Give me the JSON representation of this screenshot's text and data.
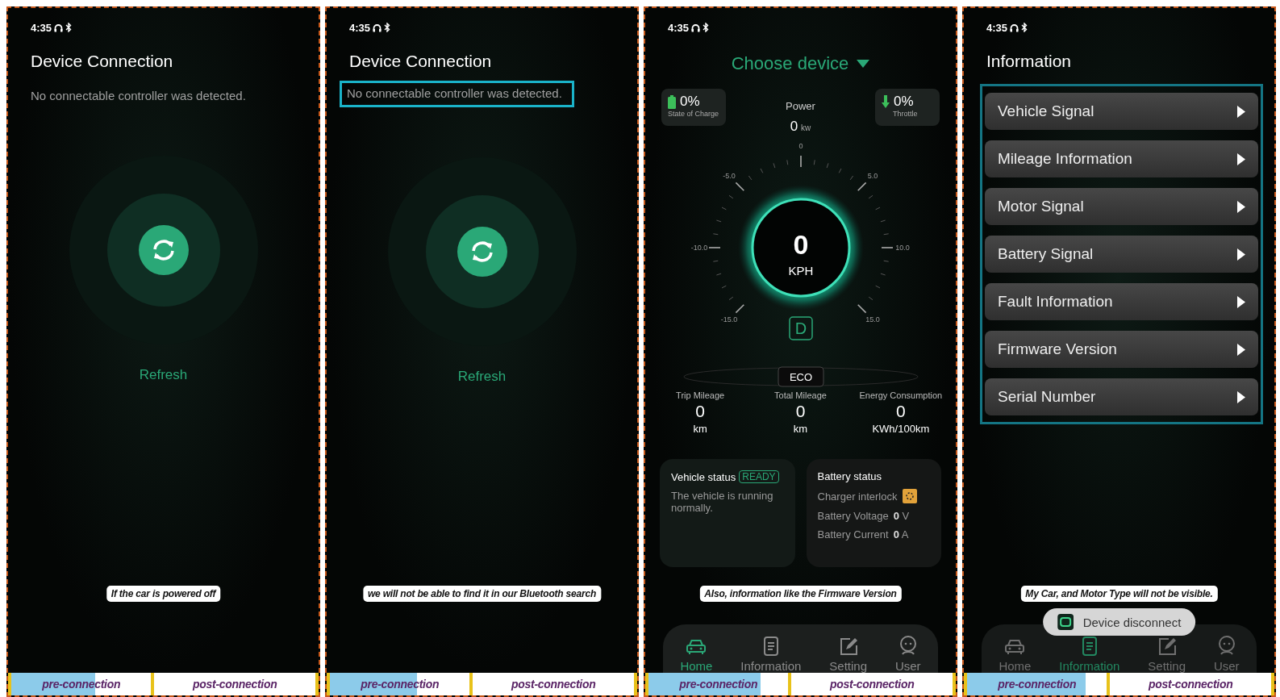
{
  "panels": [
    {
      "kind": "connection",
      "status_bar": {
        "time": "4:35"
      },
      "title": "Device Connection",
      "message": "No connectable controller was detected.",
      "message_highlighted": false,
      "refresh_label": "Refresh",
      "caption": "If the car is powered off",
      "progress": [
        {
          "label": "pre-connection",
          "level": 0.6
        },
        {
          "label": "post-connection"
        }
      ]
    },
    {
      "kind": "connection",
      "status_bar": {
        "time": "4:35"
      },
      "title": "Device Connection",
      "message": "No connectable controller was detected.",
      "message_highlighted": true,
      "refresh_label": "Refresh",
      "caption": "we will not be able to find it in our Bluetooth search",
      "progress": [
        {
          "label": "pre-connection",
          "level": 0.62
        },
        {
          "label": "post-connection"
        }
      ]
    },
    {
      "kind": "dashboard",
      "status_bar": {
        "time": "4:35"
      },
      "device_picker": "Choose device",
      "state_of_charge": {
        "value": "0%",
        "label": "State of Charge"
      },
      "power": {
        "label": "Power",
        "value": "0",
        "unit": "kw"
      },
      "throttle": {
        "value": "0%",
        "label": "Throttle"
      },
      "gauge": {
        "tick_labels": [
          "-15.0",
          "-10.0",
          "-5.0",
          "0",
          "5.0",
          "10.0",
          "15.0"
        ],
        "speed": "0",
        "unit": "KPH",
        "gear": "D",
        "mode": "ECO"
      },
      "stats": [
        {
          "label": "Trip Mileage",
          "value": "0",
          "unit": "km"
        },
        {
          "label": "Total Mileage",
          "value": "0",
          "unit": "km"
        },
        {
          "label": "Energy Consumption",
          "value": "0",
          "unit": "KWh/100km"
        }
      ],
      "vehicle_status": {
        "title": "Vehicle status",
        "badge": "READY",
        "message": "The vehicle is running normally."
      },
      "battery_status": {
        "title": "Battery status",
        "rows": [
          {
            "kind": "icon",
            "label": "Charger interlock"
          },
          {
            "kind": "reading",
            "label": "Battery Voltage",
            "value": "0",
            "unit": "V"
          },
          {
            "kind": "reading",
            "label": "Battery Current",
            "value": "0",
            "unit": "A"
          }
        ]
      },
      "nav": [
        {
          "kind": "car",
          "label": "Home",
          "selected": true
        },
        {
          "kind": "document",
          "label": "Information",
          "selected": false
        },
        {
          "kind": "edit",
          "label": "Setting",
          "selected": false
        },
        {
          "kind": "user",
          "label": "User",
          "selected": false
        }
      ],
      "caption": "Also, information like the Firmware Version",
      "progress": [
        {
          "label": "pre-connection",
          "level": 0.8
        },
        {
          "label": "post-connection"
        }
      ]
    },
    {
      "kind": "information",
      "status_bar": {
        "time": "4:35"
      },
      "title": "Information",
      "items": [
        "Vehicle Signal",
        "Mileage Information",
        "Motor Signal",
        "Battery Signal",
        "Fault Information",
        "Firmware Version",
        "Serial Number"
      ],
      "list_highlighted": true,
      "toast": "Device disconnect",
      "nav": [
        {
          "kind": "car",
          "label": "Home",
          "selected": false
        },
        {
          "kind": "document",
          "label": "Information",
          "selected": true
        },
        {
          "kind": "edit",
          "label": "Setting",
          "selected": false
        },
        {
          "kind": "user",
          "label": "User",
          "selected": false
        }
      ],
      "caption": "My Car, and Motor Type will not be visible.",
      "progress": [
        {
          "label": "pre-connection",
          "level": 0.85
        },
        {
          "label": "post-connection"
        }
      ]
    }
  ]
}
